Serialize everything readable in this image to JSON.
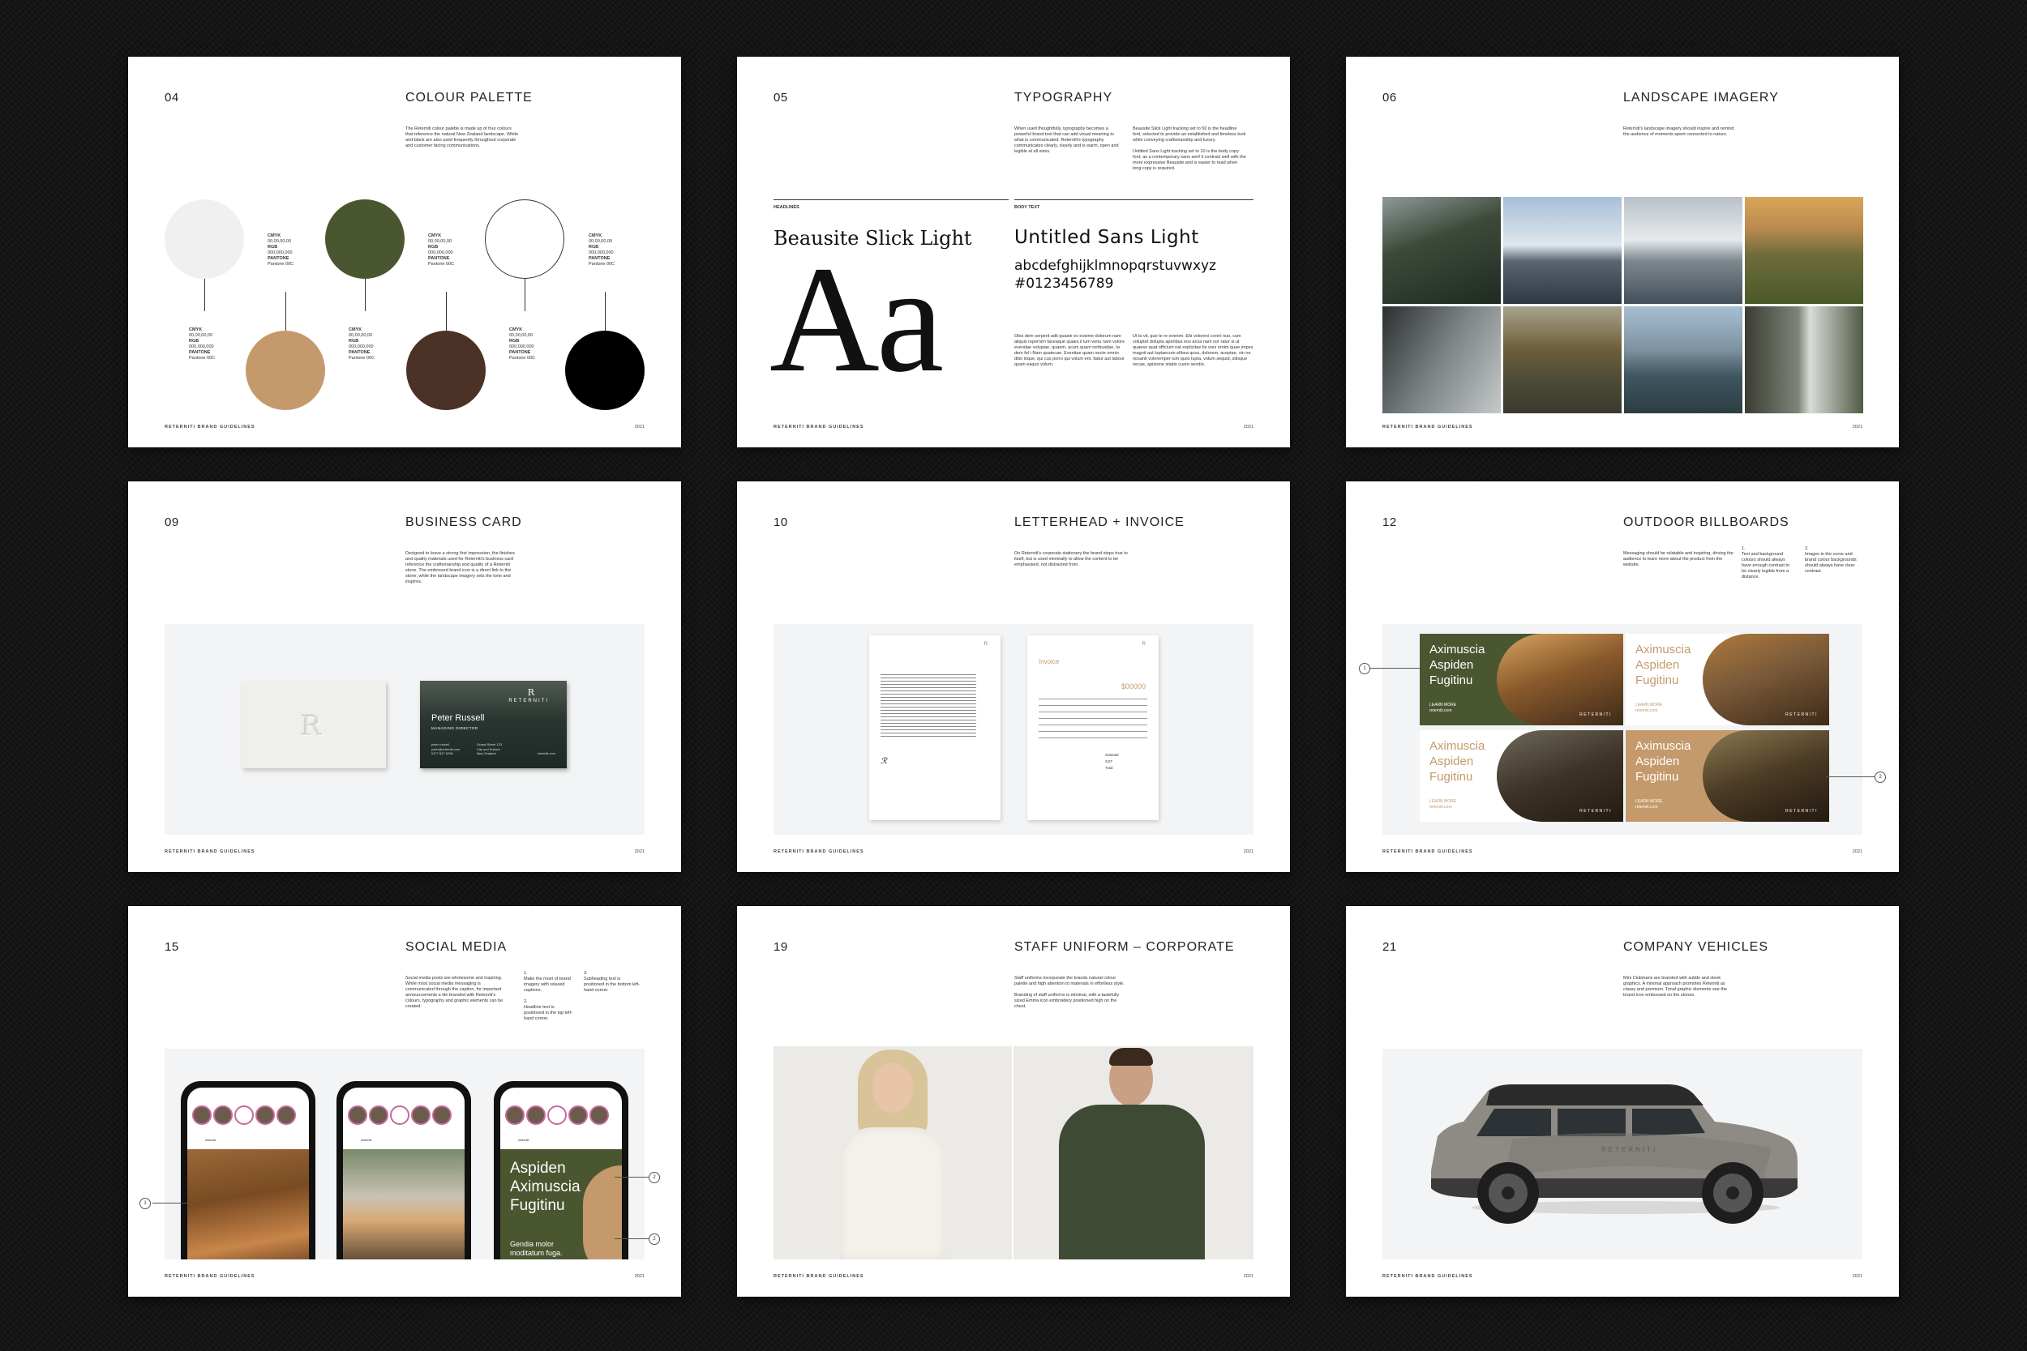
{
  "footer_label": "RETERNITI BRAND GUIDELINES",
  "footer_year": "2021",
  "pages": [
    {
      "num": "04",
      "title": "COLOUR PALETTE",
      "intro": "The Reterniti colour palette is made up of four colours that reference the natural New Zealand landscape. White and black are also used frequently throughout corporate and customer facing communications."
    },
    {
      "num": "05",
      "title": "TYPOGRAPHY"
    },
    {
      "num": "06",
      "title": "LANDSCAPE IMAGERY",
      "intro": "Reterniti's landscape imagery should inspire and remind the audience of moments spent connected to nature."
    },
    {
      "num": "09",
      "title": "BUSINESS CARD",
      "intro": "Designed to leave a strong first impression, the finishes and quality materials used for Reterniti's business card reference the craftsmanship and quality of a Reterniti stone. The embossed brand icon is a direct link to the stone, while the landscape imagery sets the tone and inspires."
    },
    {
      "num": "10",
      "title": "LETTERHEAD + INVOICE",
      "intro": "On Reterniti's corporate stationery the brand steps true to itself, but is used minimally to allow the content to be emphasised, not distracted from."
    },
    {
      "num": "12",
      "title": "OUTDOOR BILLBOARDS",
      "intro": "Messaging should be relatable and inspiring, driving the audience to learn more about the product from the website."
    },
    {
      "num": "15",
      "title": "SOCIAL MEDIA",
      "intro": "Social media posts are wholesome and inspiring. While most social media messaging is communicated through the caption, for important announcements a tile branded with Reterniti's colours, typography and graphic elements can be created."
    },
    {
      "num": "19",
      "title": "STAFF UNIFORM – CORPORATE",
      "intro": "Staff uniforms incorporate the brands natural colour palette and high attention to materials in effortless style.",
      "intro2": "Branding of staff uniforms is minimal, with a tastefully sized Emma icon embroidery positioned high on the chest."
    },
    {
      "num": "21",
      "title": "COMPANY VEHICLES",
      "intro": "Mini Clubmans are branded with subtle and sleek graphics. A minimal approach promotes Reterniti as classy and premium. Tonal graphic elements see the brand icon embossed on the stones."
    }
  ],
  "palette": [
    {
      "name": "white",
      "color": "#f0f0f0",
      "cmyk": "00,00,00,00",
      "rgb": "000,000,000",
      "pantone": "Pantone 00C"
    },
    {
      "name": "tan",
      "color": "#c49a6c",
      "cmyk": "00,00,00,00",
      "rgb": "000,000,000",
      "pantone": "Pantone 00C"
    },
    {
      "name": "green",
      "color": "#4a5630",
      "cmyk": "00,00,00,00",
      "rgb": "000,000,000",
      "pantone": "Pantone 00C"
    },
    {
      "name": "brown",
      "color": "#4b3126",
      "cmyk": "00,00,00,00",
      "rgb": "000,000,000",
      "pantone": "Pantone 00C"
    },
    {
      "name": "outline-white",
      "color": "#ffffff",
      "cmyk": "00,00,00,00",
      "rgb": "000,000,000",
      "pantone": "Pantone 00C"
    },
    {
      "name": "black",
      "color": "#000000",
      "cmyk": "00,00,00,00",
      "rgb": "000,000,000",
      "pantone": "Pantone 00C"
    }
  ],
  "palette_labels": {
    "cmyk": "CMYK",
    "rgb": "RGB",
    "pantone": "PANTONE"
  },
  "typography": {
    "intro_left": "When used thoughtfully, typography becomes a powerful brand tool that can add visual meaning to what is communicated. Reterniti's typography communicates clearly, clearly and is warm, open and legible at all sizes.",
    "intro_right": "Beausite Slick Light tracking set to 50 is the headline font, selected to provide an established and timeless look while conveying craftsmanship and luxury.",
    "intro_right2": "Untitled Sans Light tracking set to 10 is the body copy font, as a contemporary sans serif it contrast well with the more expressive Beausite and is easier to read when long copy is required.",
    "headlines_label": "HEADLINES",
    "body_label": "BODY TEXT",
    "headline_font": "Beausite Slick Light",
    "body_font": "Untitled Sans Light",
    "specimen": "Aa",
    "alphabet": "abcdefghijklmnopqrstuvwxyz",
    "numerals": "#0123456789",
    "body_sample_1": "Obis dem serperit adit quasie ex eosime dolorum nam aliquis repernim faceaque quaes il ium veriu nam volore evendae volupiae, quaem, acum quam reribusdae, ta dem fel i Nam quatecae. Evenitae quam necte omnis ditio inque, qui cus porro qui volum ent. Itatur aut labour quam eaquo volum.",
    "body_sample_2": "Ut la vit, quo te re evenim. Ebi voloreni coreri nue, cum voluptet dolupta aperibus eos arcia nam nor ratur si ut quaese quat officium nat explicitae tis vres ornim quae impes magnit aut luptaecum elibea quos, dolorem, aceptae, sin ne nosanti voloremper ium quos lupta, volum sequid, sitisque necae, apistone sitatio cuore sendio."
  },
  "business_card": {
    "brand": "RETERNITI",
    "name": "Peter Russell",
    "role": "MANAGING DIRECTOR",
    "phone": "peter russell",
    "email": "peter@reterniti.com",
    "tel": "0477 627 5256",
    "address1": "Grassi Street 123",
    "address2": "City and Suburb",
    "address3": "New Zealand",
    "web": "reterniti.com"
  },
  "invoice": {
    "title": "Invoice",
    "amount": "$00000",
    "subtotal": "Subtotal",
    "gst": "GST",
    "total": "Total"
  },
  "billboards": [
    {
      "text": "Aximuscia Aspiden Fugitinu",
      "cta": "LEARN MORE",
      "web": "reterniti.com",
      "brand": "RETERNITI",
      "panel": "#4a5630",
      "text_color": "#ffffff",
      "photo": "#6b4a2c"
    },
    {
      "text": "Aximuscia Aspiden Fugitinu",
      "cta": "LEARN MORE",
      "web": "reterniti.com",
      "brand": "RETERNITI",
      "panel": "#ffffff",
      "text_color": "#c49a6c",
      "photo": "#7a5a3a"
    },
    {
      "text": "Aximuscia Aspiden Fugitinu",
      "cta": "LEARN MORE",
      "web": "reterniti.com",
      "brand": "RETERNITI",
      "panel": "#ffffff",
      "text_color": "#c49a6c",
      "photo": "#3e3327"
    },
    {
      "text": "Aximuscia Aspiden Fugitinu",
      "cta": "LEARN MORE",
      "web": "reterniti.com",
      "brand": "RETERNITI",
      "panel": "#c49a6c",
      "text_color": "#ffffff",
      "photo": "#4b3a24"
    }
  ],
  "billboard_notes": [
    {
      "n": "1.",
      "text": "Text and background colours should always have enough contrast to be clearly legible from a distance."
    },
    {
      "n": "2.",
      "text": "Images in the curve and brand colour backgrounds should always have clear contrast."
    }
  ],
  "social": {
    "notes": [
      {
        "n": "1.",
        "text": "Make the most of brand imagery with relaxed captions."
      },
      {
        "n": "2.",
        "text": "Headline text is positioned in the top left-hand corner."
      },
      {
        "n": "3.",
        "text": "Subheading text is positioned in the bottom left-hand corner."
      }
    ],
    "post_title": "Aspiden Aximuscia Fugitinu",
    "post_sub": "Gendia molor moditatum fuga.",
    "account": "reterniti"
  },
  "callouts": {
    "one": "1",
    "two": "2"
  },
  "vehicle_brand": "RETERNITI",
  "colors": {
    "accent_green": "#4a5630",
    "tan": "#c49a6c",
    "brown": "#4b3126"
  }
}
